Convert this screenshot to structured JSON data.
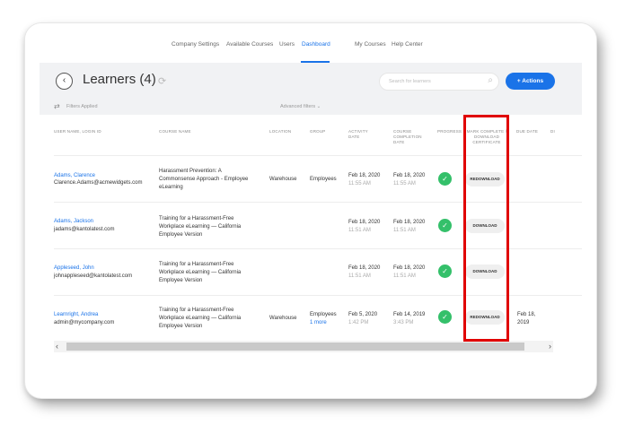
{
  "nav": {
    "company_settings": "Company Settings",
    "available_courses": "Available Courses",
    "users": "Users",
    "dashboard": "Dashboard",
    "my_courses": "My Courses",
    "help_center": "Help Center"
  },
  "header": {
    "title": "Learners (4)",
    "search_placeholder": "Search for learners",
    "actions_label": "+ Actions"
  },
  "filters": {
    "applied": "Filters Applied",
    "advanced": "Advanced filters ⌄"
  },
  "columns": {
    "user": "USER NAME, LOGIN ID",
    "course": "COURSE NAME",
    "location": "LOCATION",
    "group": "GROUP",
    "activity": "ACTIVITY DATE",
    "completion": "COURSE COMPLETION DATE",
    "progress": "PROGRESS",
    "mark": "MARK COMPLETE / DOWNLOAD CERTIFICATE",
    "due": "DUE DATE",
    "extra": "DI"
  },
  "rows": [
    {
      "name": "Adams, Clarence",
      "login": "Clarence.Adams@acmewidgets.com",
      "course_1": "Harassment Prevention: A",
      "course_2": "Commonsense Approach - Employee",
      "course_3": "eLearning",
      "location": "Warehouse",
      "group": "Employees",
      "group_more": "",
      "activity_date": "Feb 18, 2020",
      "activity_time": "11:55 AM",
      "completion_date": "Feb 18, 2020",
      "completion_time": "11:55 AM",
      "progress": "complete",
      "button": "REDOWNLOAD",
      "due_1": "",
      "due_2": ""
    },
    {
      "name": "Adams, Jackson",
      "login": "jadams@kantolatest.com",
      "course_1": "Training for a Harassment-Free",
      "course_2": "Workplace eLearning — California",
      "course_3": "Employee Version",
      "location": "",
      "group": "",
      "group_more": "",
      "activity_date": "Feb 18, 2020",
      "activity_time": "11:51 AM",
      "completion_date": "Feb 18, 2020",
      "completion_time": "11:51 AM",
      "progress": "complete",
      "button": "DOWNLOAD",
      "due_1": "",
      "due_2": ""
    },
    {
      "name": "Appleseed, John",
      "login": "johnappleseed@kantolatest.com",
      "course_1": "Training for a Harassment-Free",
      "course_2": "Workplace eLearning — California",
      "course_3": "Employee Version",
      "location": "",
      "group": "",
      "group_more": "",
      "activity_date": "Feb 18, 2020",
      "activity_time": "11:51 AM",
      "completion_date": "Feb 18, 2020",
      "completion_time": "11:51 AM",
      "progress": "complete",
      "button": "DOWNLOAD",
      "due_1": "",
      "due_2": ""
    },
    {
      "name": "Learnright, Andrea",
      "login": "admin@mycompany.com",
      "course_1": "Training for a Harassment-Free",
      "course_2": "Workplace eLearning — California",
      "course_3": "Employee Version",
      "location": "Warehouse",
      "group": "Employees",
      "group_more": "1 more",
      "activity_date": "Feb 5, 2020",
      "activity_time": "1:42 PM",
      "completion_date": "Feb 14, 2019",
      "completion_time": "3:43 PM",
      "progress": "complete",
      "button": "REDOWNLOAD",
      "due_1": "Feb 18,",
      "due_2": "2019"
    }
  ],
  "scroll": {
    "left": "‹",
    "right": "›"
  },
  "colors": {
    "accent": "#1a73e8",
    "success": "#34c06a",
    "highlight": "#e00000"
  }
}
